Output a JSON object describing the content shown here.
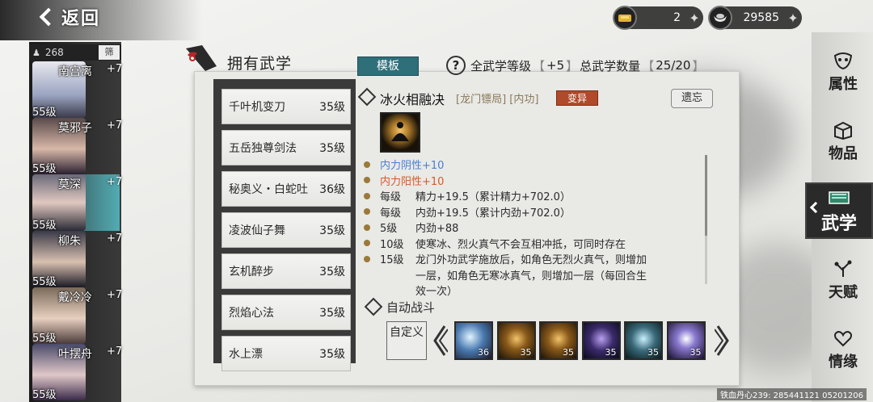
{
  "header": {
    "back_label": "返回",
    "gold": "2",
    "silver": "29585",
    "title": "拥有武学",
    "template_button": "模板",
    "stats": {
      "all_label": "全武学等级",
      "all_value": "+5",
      "total_label": "总武学数量",
      "total_value": "25/20"
    }
  },
  "roster": {
    "count": "268",
    "filter_label": "筛",
    "characters": [
      {
        "name": "南宫离",
        "bonus": "+7",
        "level": "55级",
        "active": false
      },
      {
        "name": "莫邪子",
        "bonus": "+7",
        "level": "55级",
        "active": false
      },
      {
        "name": "莫深",
        "bonus": "+7",
        "level": "55级",
        "active": true
      },
      {
        "name": "柳朱",
        "bonus": "+7",
        "level": "55级",
        "active": false
      },
      {
        "name": "戴冷冷",
        "bonus": "+7",
        "level": "55级",
        "active": false
      },
      {
        "name": "叶摆舟",
        "bonus": "+7",
        "level": "55级",
        "active": false
      }
    ]
  },
  "skills": [
    {
      "name": "千叶机变刀",
      "level": "35级"
    },
    {
      "name": "五岳独尊剑法",
      "level": "35级"
    },
    {
      "name": "秘奥义・白蛇吐",
      "level": "36级"
    },
    {
      "name": "凌波仙子舞",
      "level": "35级"
    },
    {
      "name": "玄机醉步",
      "level": "35级"
    },
    {
      "name": "烈焰心法",
      "level": "35级"
    },
    {
      "name": "水上漂",
      "level": "35级"
    }
  ],
  "detail": {
    "name": "冰火相融决",
    "tags": "[龙门镖局] [内功]",
    "mutation": "变异",
    "forget_button": "遗忘",
    "attributes": [
      {
        "key": "",
        "text": "内力阴性+10",
        "style": "yin"
      },
      {
        "key": "",
        "text": "内力阳性+10",
        "style": "yang"
      },
      {
        "key": "每级",
        "text": "精力+19.5（累计精力+702.0）",
        "style": ""
      },
      {
        "key": "每级",
        "text": "内劲+19.5（累计内劲+702.0）",
        "style": ""
      },
      {
        "key": "5级",
        "text": "内劲+88",
        "style": ""
      },
      {
        "key": "10级",
        "text": "使寒冰、烈火真气不会互相冲抵，可同时存在",
        "style": ""
      },
      {
        "key": "15级",
        "text": "龙门外功武学施放后，如角色无烈火真气，则增加",
        "style": ""
      },
      {
        "key": "",
        "text": "一层，如角色无寒冰真气，则增加一层（每回合生",
        "style": ""
      },
      {
        "key": "",
        "text": "效一次）",
        "style": ""
      }
    ],
    "auto_battle_title": "自动战斗",
    "custom_button": "自定义",
    "auto_slots": [
      "36",
      "35",
      "35",
      "35",
      "35",
      "35"
    ]
  },
  "nav": [
    {
      "label": "属性",
      "icon": "mask-icon"
    },
    {
      "label": "物品",
      "icon": "box-icon"
    },
    {
      "label": "武学",
      "icon": "book-icon",
      "active": true
    },
    {
      "label": "天赋",
      "icon": "branch-icon"
    },
    {
      "label": "情缘",
      "icon": "heart-icon"
    }
  ],
  "footer": "铁血丹心239: 285441121 05201206",
  "colors": {
    "accent": "#2e6f7a",
    "mutation": "#b04a2a",
    "yin": "#4a7fd0",
    "yang": "#d65a2a",
    "active_char": "#5ad2dc"
  }
}
